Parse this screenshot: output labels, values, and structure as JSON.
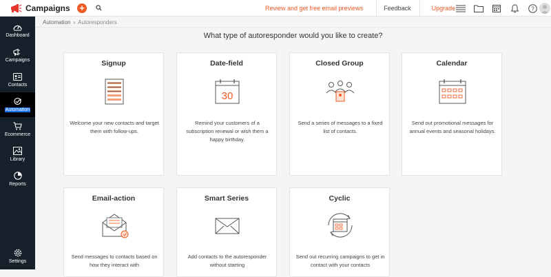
{
  "app": {
    "name": "Campaigns"
  },
  "topbar": {
    "review_link": "Review and get free email previews",
    "feedback_link": "Feedback",
    "upgrade_link": "Upgrade"
  },
  "sidebar": {
    "items": [
      {
        "label": "Dashboard",
        "icon": "dashboard-icon"
      },
      {
        "label": "Campaigns",
        "icon": "megaphone-icon"
      },
      {
        "label": "Contacts",
        "icon": "contacts-icon"
      },
      {
        "label": "Automation",
        "icon": "automation-icon",
        "active": true
      },
      {
        "label": "Ecommerce",
        "icon": "cart-icon"
      },
      {
        "label": "Library",
        "icon": "library-icon"
      },
      {
        "label": "Reports",
        "icon": "pie-chart-icon"
      }
    ],
    "settings_label": "Settings"
  },
  "breadcrumb": {
    "parent": "Automation",
    "current": "Autoresponders"
  },
  "heading": "What type of autoresponder would you like to create?",
  "cards": [
    {
      "title": "Signup",
      "desc": "Welcome your new contacts and target them with follow-ups.",
      "icon": "signup-form-icon"
    },
    {
      "title": "Date-field",
      "desc": "Remind your customers of a subscription renewal or wish them a happy birthday.",
      "icon": "calendar-date-icon",
      "date_number": "30"
    },
    {
      "title": "Closed Group",
      "desc": "Send a series of messages to a fixed list of contacts.",
      "icon": "group-icon"
    },
    {
      "title": "Calendar",
      "desc": "Send out promotional messages for annual events and seasonal holidays.",
      "icon": "calendar-icon"
    },
    {
      "title": "Email-action",
      "desc": "Send messages to contacts based on how they interact with",
      "icon": "envelope-icon"
    },
    {
      "title": "Smart Series",
      "desc": "Add contacts to the autoresponder without starting",
      "icon": "smart-series-icon"
    },
    {
      "title": "Cyclic",
      "desc": "Send out recurring campaigns to get in contact with your contacts",
      "icon": "cyclic-calendar-icon"
    }
  ],
  "colors": {
    "accent": "#f15a24",
    "sidebar_bg": "#15202b",
    "active_highlight": "#1a73e8"
  }
}
